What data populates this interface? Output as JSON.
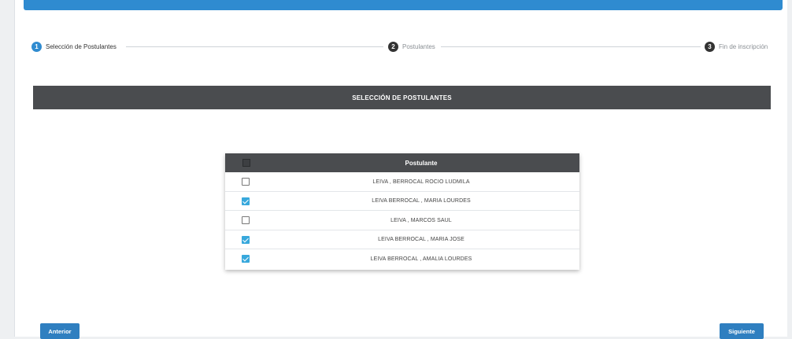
{
  "stepper": {
    "steps": [
      {
        "number": "1",
        "label": "Selección de Postulantes",
        "active": true
      },
      {
        "number": "2",
        "label": "Postulantes",
        "active": false
      },
      {
        "number": "3",
        "label": "Fin de inscripción",
        "active": false
      }
    ]
  },
  "section": {
    "title": "SELECCIÓN DE POSTULANTES"
  },
  "table": {
    "header": "Postulante",
    "rows": [
      {
        "name": "LEIVA , BERROCAL ROCIO LUDMILA",
        "checked": false
      },
      {
        "name": "LEIVA BERROCAL , MARIA LOURDES",
        "checked": true
      },
      {
        "name": "LEIVA , MARCOS SAUL",
        "checked": false
      },
      {
        "name": "LEIVA BERROCAL , MARIA JOSE",
        "checked": true
      },
      {
        "name": "LEIVA BERROCAL , AMALIA LOURDES",
        "checked": true
      }
    ]
  },
  "buttons": {
    "previous": "Anterior",
    "next": "Siguiente"
  },
  "colors": {
    "accent": "#2f8bd0",
    "header_bg": "#4a4c4f",
    "checkbox_checked": "#38a8dc"
  }
}
